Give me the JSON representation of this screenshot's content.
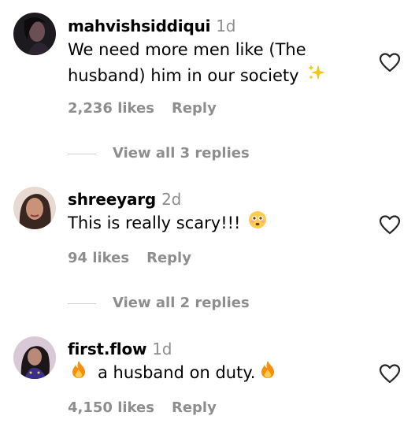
{
  "comments": [
    {
      "username": "mahvishsiddiqui",
      "age": "1d",
      "text_lines": [
        "We need more men like (The",
        "husband) him in our society"
      ],
      "trailing_emoji": "sparkles-emoji",
      "likes": "2,236 likes",
      "reply_label": "Reply",
      "view_replies": "View all 3 replies"
    },
    {
      "username": "shreeyarg",
      "age": "2d",
      "text": "This is really scary!!!",
      "trailing_emoji": "flushed-face-emoji",
      "likes": "94 likes",
      "reply_label": "Reply",
      "view_replies": "View all 2 replies"
    },
    {
      "username": "first.flow",
      "age": "1d",
      "text": "a husband on duty.",
      "leading_emoji": "fire-emoji",
      "trailing_emoji": "fire-emoji",
      "likes": "4,150 likes",
      "reply_label": "Reply"
    }
  ],
  "icons": {
    "like": "heart-outline-icon"
  },
  "colors": {
    "secondary_text": "#8e8e8e",
    "divider": "#cfcfcf"
  }
}
